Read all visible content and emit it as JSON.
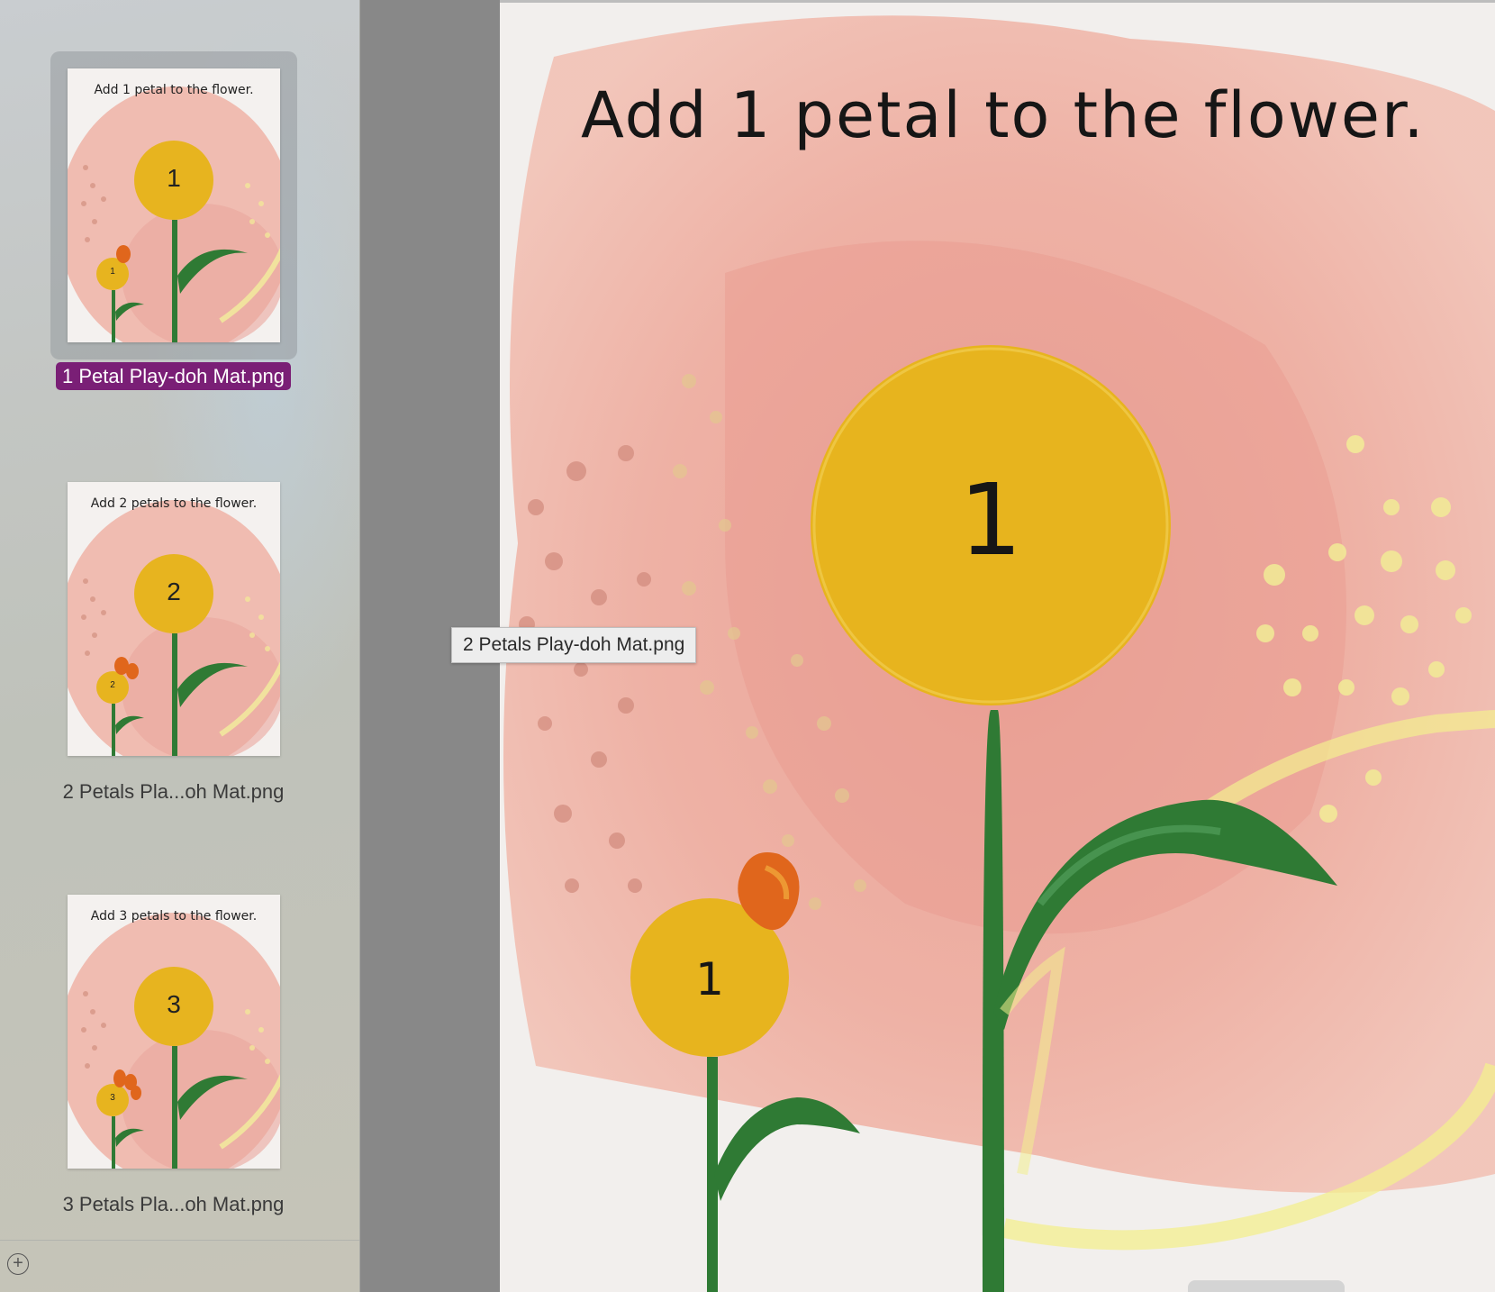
{
  "sidebar": {
    "pages": [
      {
        "title": "Add 1 petal to the flower.",
        "number": "1",
        "small_number": "1",
        "label": "1 Petal Play-doh Mat.png",
        "selected": true
      },
      {
        "title": "Add 2 petals to the flower.",
        "number": "2",
        "small_number": "2",
        "label": "2 Petals Pla...oh Mat.png",
        "selected": false
      },
      {
        "title": "Add 3 petals to the flower.",
        "number": "3",
        "small_number": "3",
        "label": "3 Petals Pla...oh Mat.png",
        "selected": false
      }
    ],
    "add_icon": "plus-circle-icon",
    "selection_color": "#7a1f76"
  },
  "main": {
    "title": "Add 1 petal to the flower.",
    "big_number": "1",
    "small_number": "1"
  },
  "tooltip": {
    "text": "2 Petals Play-doh Mat.png"
  }
}
